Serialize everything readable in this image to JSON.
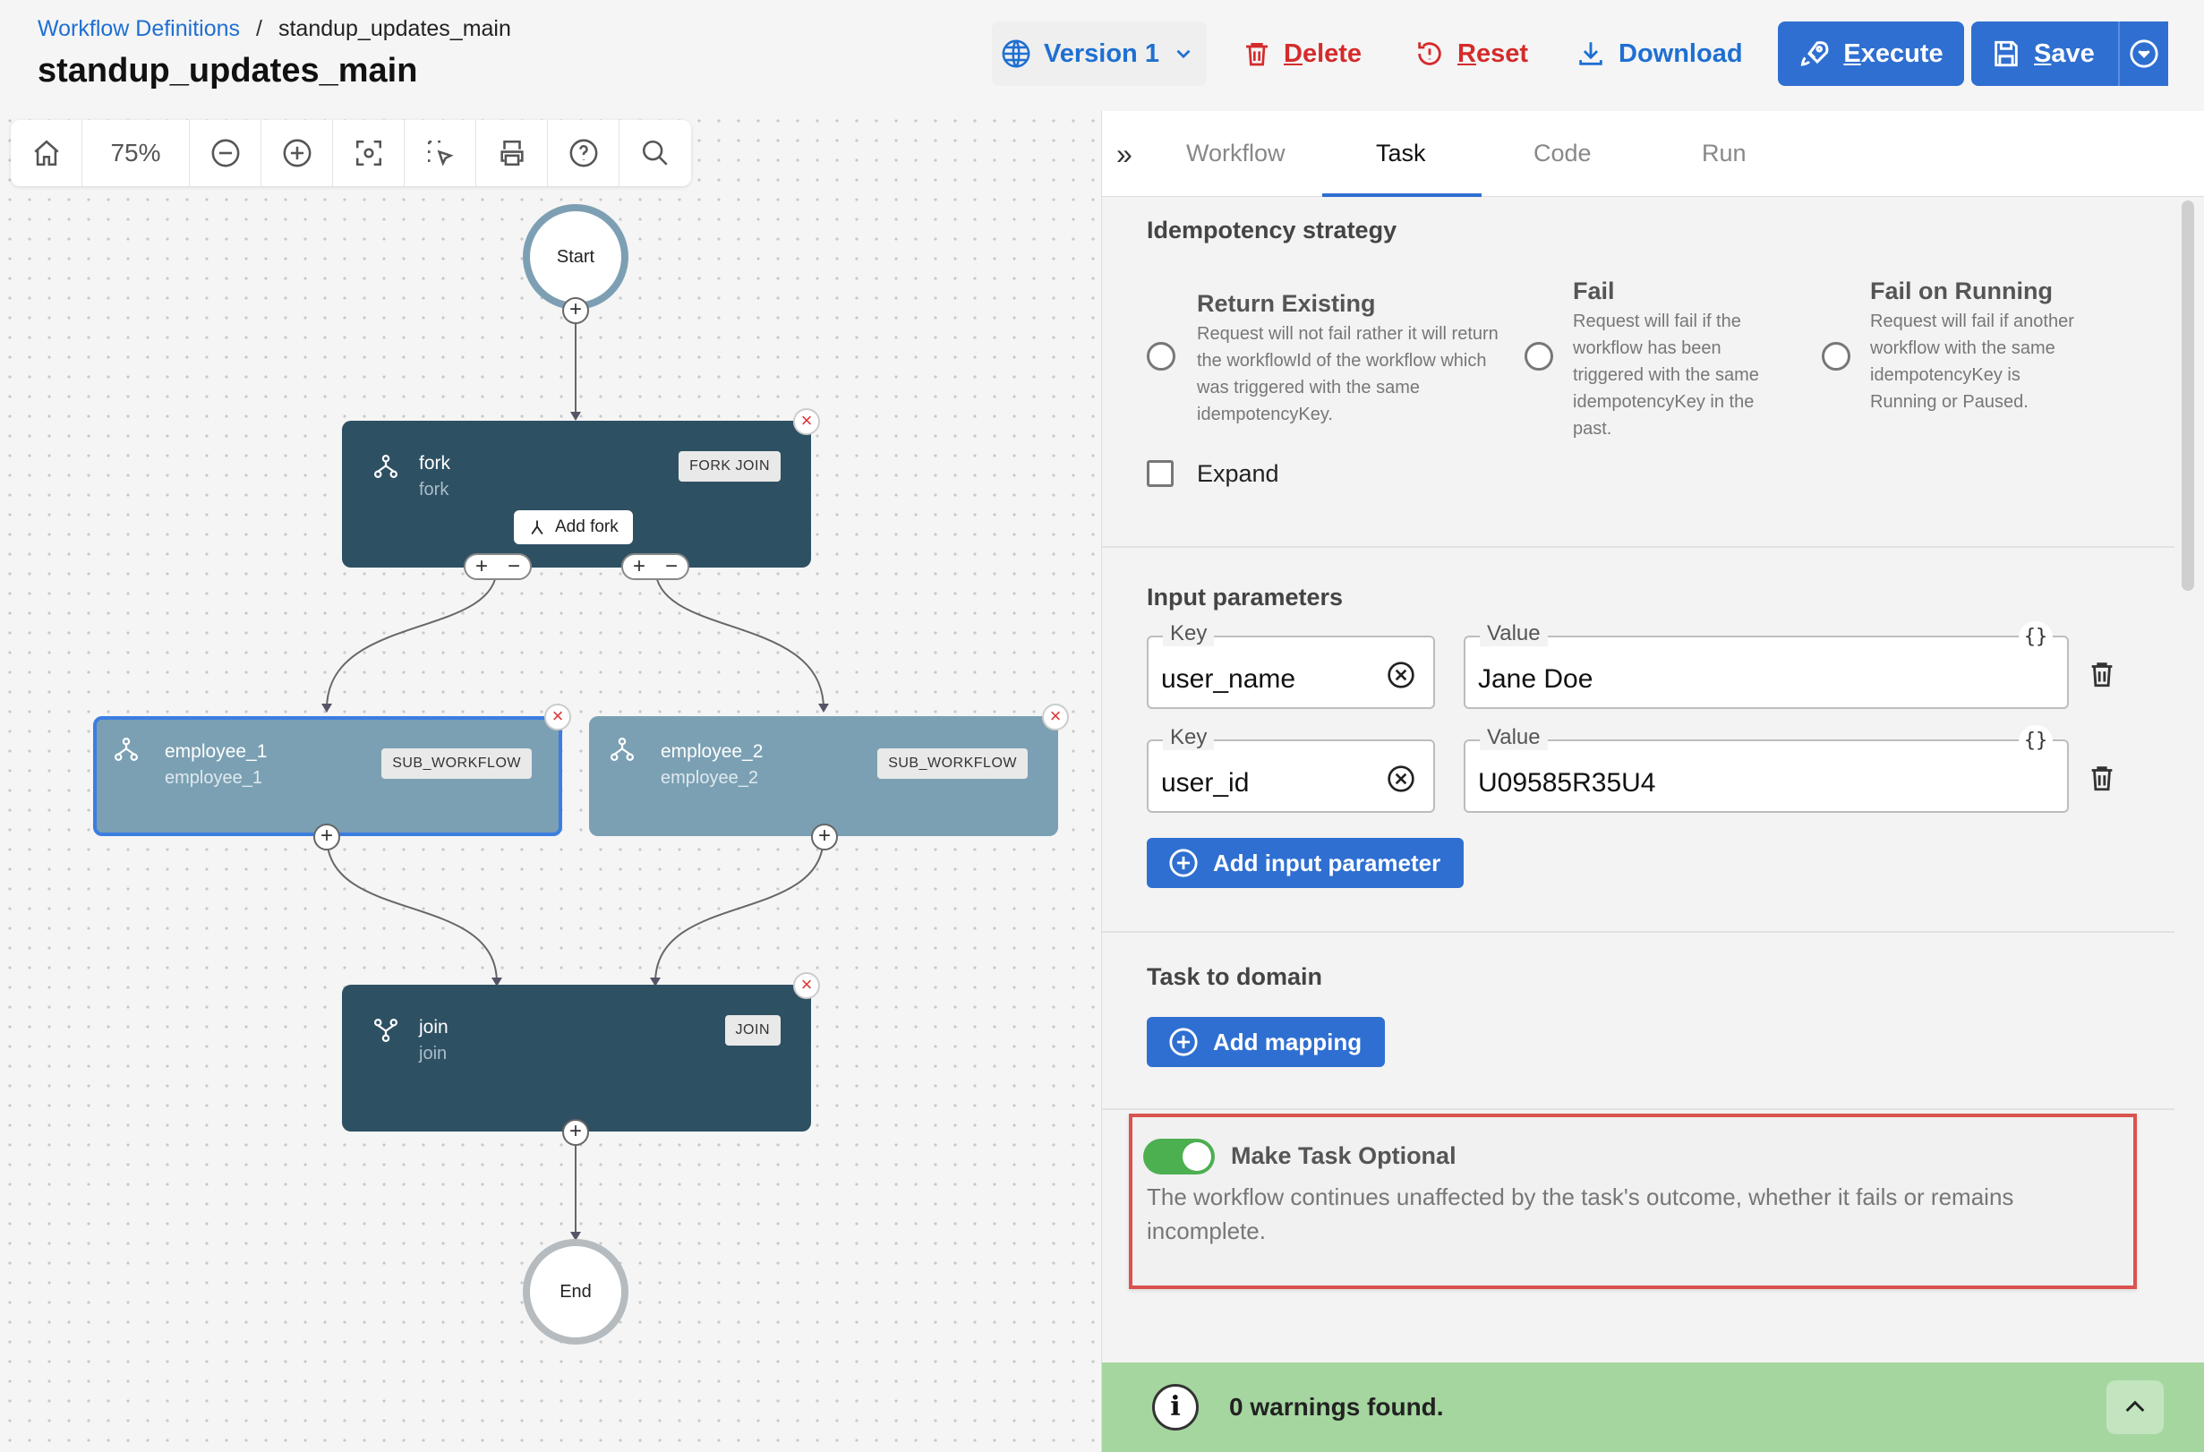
{
  "header": {
    "breadcrumb_link": "Workflow Definitions",
    "breadcrumb_sep": "/",
    "breadcrumb_current": "standup_updates_main",
    "title": "standup_updates_main",
    "version_label": "Version 1",
    "delete_label": "Delete",
    "reset_label": "Reset",
    "download_label": "Download",
    "execute_label": "Execute",
    "save_label": "Save"
  },
  "toolbar": {
    "zoom": "75%"
  },
  "flow": {
    "start_label": "Start",
    "end_label": "End",
    "fork": {
      "title": "fork",
      "sub": "fork",
      "badge": "FORK JOIN",
      "add_fork": "Add fork"
    },
    "employee_1": {
      "title": "employee_1",
      "sub": "employee_1",
      "badge": "SUB_WORKFLOW"
    },
    "employee_2": {
      "title": "employee_2",
      "sub": "employee_2",
      "badge": "SUB_WORKFLOW"
    },
    "join": {
      "title": "join",
      "sub": "join",
      "badge": "JOIN"
    }
  },
  "tabs": {
    "workflow": "Workflow",
    "task": "Task",
    "code": "Code",
    "run": "Run"
  },
  "idempotency": {
    "title": "Idempotency strategy",
    "options": [
      {
        "title": "Return Existing",
        "desc": "Request will not fail rather it will return the workflowId of the workflow which was triggered with the same idempotencyKey."
      },
      {
        "title": "Fail",
        "desc": "Request will fail if the workflow has been triggered with the same idempotencyKey in the past."
      },
      {
        "title": "Fail on Running",
        "desc": "Request will fail if another workflow with the same idempotencyKey is Running or Paused."
      }
    ],
    "expand_label": "Expand"
  },
  "inputs": {
    "title": "Input parameters",
    "key_label": "Key",
    "value_label": "Value",
    "rows": [
      {
        "key": "user_name",
        "value": "Jane Doe"
      },
      {
        "key": "user_id",
        "value": "U09585R35U4"
      }
    ],
    "add_label": "Add input parameter",
    "json_glyph": "{}"
  },
  "domain": {
    "title": "Task to domain",
    "add_label": "Add mapping"
  },
  "optional": {
    "title": "Make Task Optional",
    "enabled": true,
    "desc": "The workflow continues unaffected by the task's outcome, whether it fails or remains incomplete."
  },
  "warnings": {
    "text": "0 warnings found."
  },
  "colors": {
    "primary": "#2f6fd1",
    "danger": "#d42b2b",
    "node_dark": "#2e5063",
    "node_light": "#7ba0b3",
    "success_bar": "#a5d6a0",
    "toggle_on": "#4caf50",
    "highlight_border": "#d9534f"
  }
}
